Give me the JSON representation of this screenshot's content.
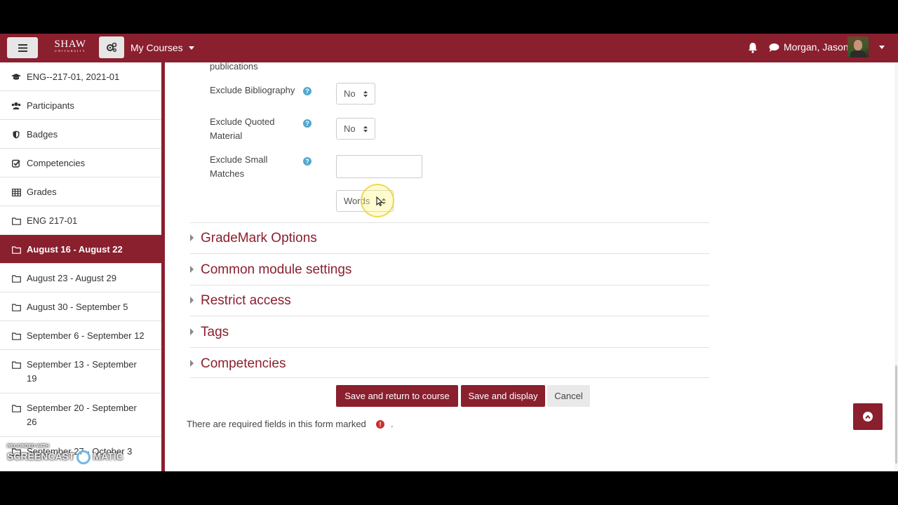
{
  "navbar": {
    "logo_line1": "SHAW",
    "logo_line2": "UNIVERSITY",
    "my_courses": "My Courses",
    "user_name": "Morgan, Jason"
  },
  "sidebar": {
    "items": [
      {
        "label": "ENG--217-01, 2021-01",
        "icon": "graduation-cap-icon"
      },
      {
        "label": "Participants",
        "icon": "users-icon"
      },
      {
        "label": "Badges",
        "icon": "shield-icon"
      },
      {
        "label": "Competencies",
        "icon": "check-square-icon"
      },
      {
        "label": "Grades",
        "icon": "table-icon"
      },
      {
        "label": "ENG 217-01",
        "icon": "folder-icon"
      },
      {
        "label": "August 16 - August 22",
        "icon": "folder-icon",
        "active": true
      },
      {
        "label": "August 23 - August 29",
        "icon": "folder-icon"
      },
      {
        "label": "August 30 - September 5",
        "icon": "folder-icon"
      },
      {
        "label": "September 6 - September 12",
        "icon": "folder-icon"
      },
      {
        "label": "September 13 - September 19",
        "icon": "folder-icon"
      },
      {
        "label": "September 20 - September 26",
        "icon": "folder-icon"
      },
      {
        "label": "September 27 - October 3",
        "icon": "folder-icon"
      }
    ]
  },
  "form": {
    "publications_label": "publications",
    "exclude_bibliography": {
      "label": "Exclude Bibliography",
      "value": "No"
    },
    "exclude_quoted": {
      "label": "Exclude Quoted Material",
      "value": "No"
    },
    "exclude_small": {
      "label": "Exclude Small Matches",
      "input_value": "",
      "unit": "Words"
    },
    "sections": [
      "GradeMark Options",
      "Common module settings",
      "Restrict access",
      "Tags",
      "Competencies"
    ],
    "buttons": {
      "save_return": "Save and return to course",
      "save_display": "Save and display",
      "cancel": "Cancel"
    },
    "required_note": "There are required fields in this form marked",
    "required_suffix": "."
  },
  "watermark": {
    "small": "RECORDED WITH",
    "large_left": "SCREENCAST",
    "large_right": "MATIC"
  },
  "colors": {
    "brand": "#8a1f2e",
    "help": "#53a9cf",
    "required": "#c9302c"
  }
}
